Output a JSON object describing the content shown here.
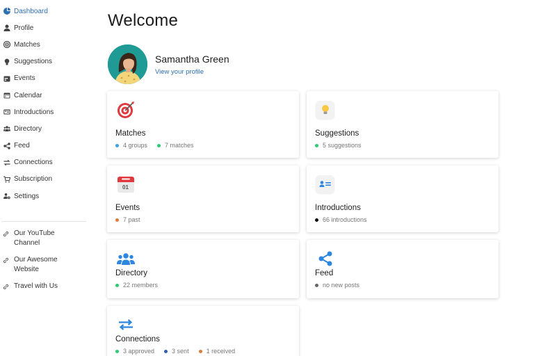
{
  "sidebar": {
    "items": [
      {
        "label": "Dashboard",
        "icon": "dashboard-icon"
      },
      {
        "label": "Profile",
        "icon": "user-icon"
      },
      {
        "label": "Matches",
        "icon": "target-icon"
      },
      {
        "label": "Suggestions",
        "icon": "lightbulb-icon"
      },
      {
        "label": "Events",
        "icon": "calendar-alt-icon"
      },
      {
        "label": "Calendar",
        "icon": "calendar-icon"
      },
      {
        "label": "Introductions",
        "icon": "id-card-icon"
      },
      {
        "label": "Directory",
        "icon": "users-icon"
      },
      {
        "label": "Feed",
        "icon": "share-icon"
      },
      {
        "label": "Connections",
        "icon": "exchange-icon"
      },
      {
        "label": "Subscription",
        "icon": "cart-icon"
      },
      {
        "label": "Settings",
        "icon": "users-cog-icon"
      }
    ],
    "links": [
      {
        "label": "Our YouTube Channel",
        "icon": "link-icon"
      },
      {
        "label": "Our Awesome Website",
        "icon": "link-icon"
      },
      {
        "label": "Travel with Us",
        "icon": "link-icon"
      }
    ]
  },
  "main": {
    "title": "Welcome",
    "profile": {
      "name": "Samantha Green",
      "link": "View your profile"
    },
    "cards": {
      "matches": {
        "title": "Matches",
        "stats": [
          {
            "text": "4 groups",
            "color": "#3aa3e3"
          },
          {
            "text": "7 matches",
            "color": "#2ecc71"
          }
        ]
      },
      "suggestions": {
        "title": "Suggestions",
        "stats": [
          {
            "text": "5 suggestions",
            "color": "#2ecc71"
          }
        ]
      },
      "events": {
        "title": "Events",
        "calendar_day": "01",
        "stats": [
          {
            "text": "7 past",
            "color": "#e07b39"
          }
        ]
      },
      "introductions": {
        "title": "Introductions",
        "stats": [
          {
            "text": "66 introductions",
            "color": "#111111"
          }
        ]
      },
      "directory": {
        "title": "Directory",
        "stats": [
          {
            "text": "22 members",
            "color": "#2ecc71"
          }
        ]
      },
      "feed": {
        "title": "Feed",
        "stats": [
          {
            "text": "no new posts",
            "color": "#666666"
          }
        ]
      },
      "connections": {
        "title": "Connections",
        "stats": [
          {
            "text": "3 approved",
            "color": "#2ecc71"
          },
          {
            "text": "3 sent",
            "color": "#2f5fb3"
          },
          {
            "text": "1 received",
            "color": "#e07b39"
          }
        ]
      }
    }
  },
  "colors": {
    "accent": "#2f6fb3",
    "icon_blue": "#2e86de"
  }
}
